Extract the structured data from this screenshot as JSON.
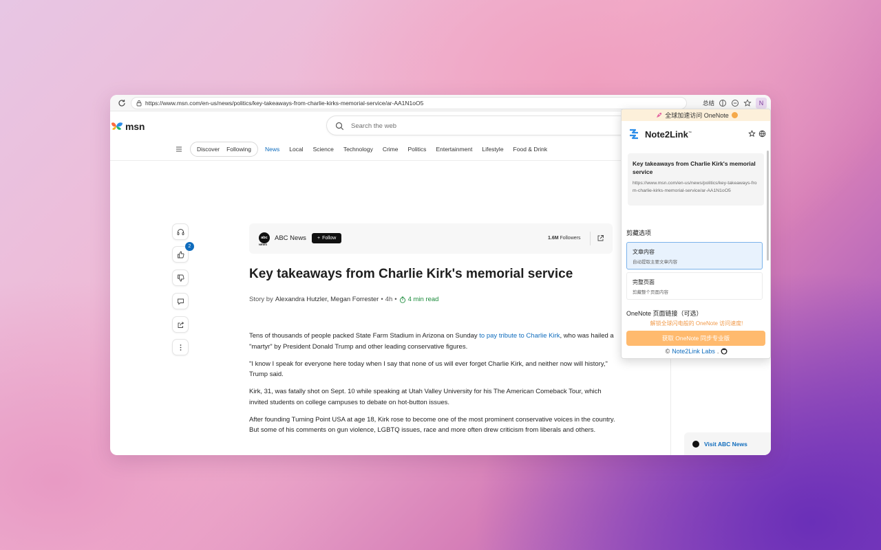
{
  "browser": {
    "url": "https://www.msn.com/en-us/news/politics/key-takeaways-from-charlie-kirks-memorial-service/ar-AA1N1oO5",
    "toolbar_label": "总结",
    "extension_label": "N"
  },
  "msn": {
    "logo_text": "msn",
    "search_placeholder": "Search the web",
    "pill": [
      "Discover",
      "Following"
    ],
    "nav": [
      "News",
      "Local",
      "Science",
      "Technology",
      "Crime",
      "Politics",
      "Entertainment",
      "Lifestyle",
      "Food & Drink"
    ],
    "active_nav": "News",
    "like_count": "2",
    "accent": "#0f6cbd"
  },
  "source": {
    "logo": "abc",
    "logo_sub": "NEWS",
    "name": "ABC News",
    "follow": "Follow",
    "followers_count": "1.6M",
    "followers_label": "Followers"
  },
  "article": {
    "title": "Key takeaways from Charlie Kirk's memorial service",
    "story_by": "Story by",
    "authors": "Alexandra Hutzler, Megan Forrester",
    "time": "4h",
    "read_time": "4 min read",
    "p1_a": "Tens of thousands of people packed State Farm Stadium in Arizona on Sunday ",
    "p1_link": "to pay tribute to Charlie Kirk",
    "p1_b": ", who was hailed a \"martyr\" by President Donald Trump and other leading conservative figures.",
    "p2": "\"I know I speak for everyone here today when I say that none of us will ever forget Charlie Kirk, and neither now will history,\" Trump said.",
    "p3": "Kirk, 31, was fatally shot on Sept. 10 while speaking at Utah Valley University for his The American Comeback Tour, which invited students on college campuses to debate on hot-button issues.",
    "p4": "After founding Turning Point USA at age 18, Kirk rose to become one of the most prominent conservative voices in the country. But some of his comments on gun violence, LGBTQ issues, race and more often drew criticism from liberals and others."
  },
  "sidebar": {
    "visit": "Visit ABC News"
  },
  "popup": {
    "promo": "全球加速访问 OneNote",
    "brand": "Note2Link",
    "brand_tm": "™",
    "page_title": "Key takeaways from Charlie Kirk's memorial service",
    "page_url": "https://www.msn.com/en-us/news/politics/key-takeaways-from-charlie-kirks-memorial-service/ar-AA1N1oO5",
    "clip_options_label": "剪藏选项",
    "options": [
      {
        "title": "文章内容",
        "desc": "自动提取主要文章内容"
      },
      {
        "title": "完整页面",
        "desc": "剪藏整个页面内容"
      }
    ],
    "link_label": "OneNote 页面链接（可选）",
    "unlock_text": "解锁全球闪电般的 OneNote 访问速度!",
    "pro_button": "获取 OneNote 同步专业版",
    "footer_prefix": "©",
    "footer_link": "Note2Link Labs",
    "footer_suffix": ".",
    "accent_orange": "#ffba6e",
    "selected_border": "#7ab2ea"
  }
}
